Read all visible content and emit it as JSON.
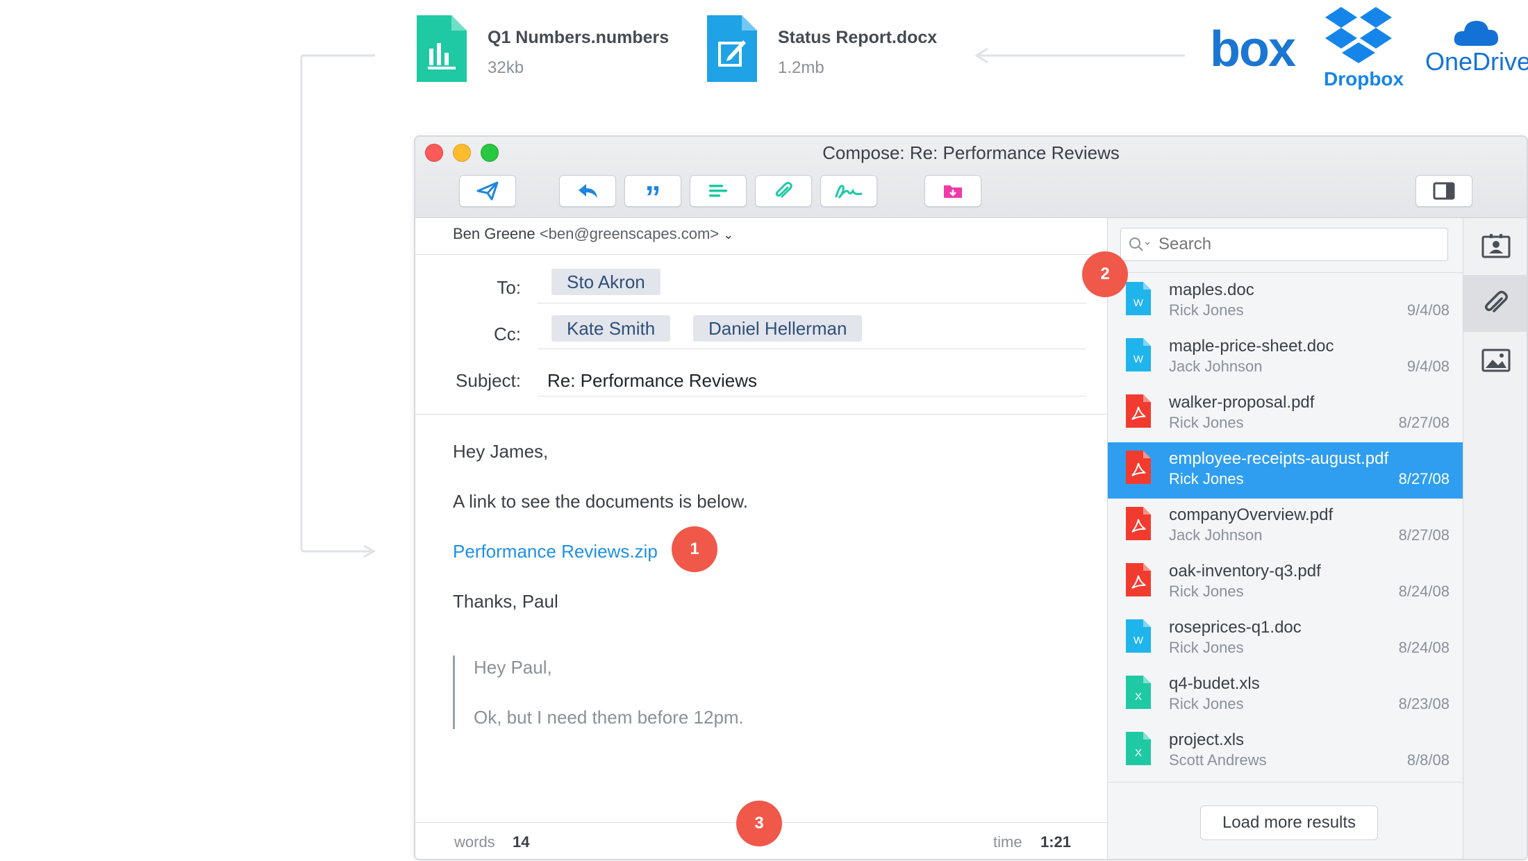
{
  "top_files": [
    {
      "name": "Q1 Numbers.numbers",
      "size": "32kb",
      "color": "#1ec9a4"
    },
    {
      "name": "Status Report.docx",
      "size": "1.2mb",
      "color": "#1fa2e6"
    }
  ],
  "services": {
    "box": "box",
    "dropbox": "Dropbox",
    "onedrive": "OneDrive"
  },
  "window": {
    "title": "Compose: Re: Performance Reviews"
  },
  "toolbar": [
    "send-icon",
    "reply-icon",
    "quote-icon",
    "format-icon",
    "attach-icon",
    "signature-icon",
    "save-folder-icon",
    "sidebar-toggle-icon"
  ],
  "compose": {
    "from_name": "Ben Greene",
    "from_email": "<ben@greenscapes.com>",
    "to_label": "To:",
    "to": [
      "Sto Akron"
    ],
    "cc_label": "Cc:",
    "cc": [
      "Kate Smith",
      "Daniel Hellerman"
    ],
    "subject_label": "Subject:",
    "subject": "Re: Performance Reviews",
    "greeting": "Hey James,",
    "line1": "A link to see the documents is below.",
    "link": "Performance Reviews.zip",
    "signoff": "Thanks, Paul",
    "quote_line1": "Hey Paul,",
    "quote_line2": "Ok, but I need them before 12pm.",
    "words_label": "words",
    "words_value": "14",
    "time_label": "time",
    "time_value": "1:21"
  },
  "badges": {
    "b1": "1",
    "b2": "2",
    "b3": "3"
  },
  "search": {
    "placeholder": "Search"
  },
  "files": [
    {
      "name": "maples.doc",
      "owner": "Rick Jones",
      "date": "9/4/08",
      "type": "W",
      "color": "#1fb4ec"
    },
    {
      "name": "maple-price-sheet.doc",
      "owner": "Jack Johnson",
      "date": "9/4/08",
      "type": "W",
      "color": "#1fb4ec"
    },
    {
      "name": "walker-proposal.pdf",
      "owner": "Rick Jones",
      "date": "8/27/08",
      "type": "pdf",
      "color": "#f23b2f"
    },
    {
      "name": "employee-receipts-august.pdf",
      "owner": "Rick Jones",
      "date": "8/27/08",
      "type": "pdf",
      "color": "#f23b2f"
    },
    {
      "name": "companyOverview.pdf",
      "owner": "Jack Johnson",
      "date": "8/27/08",
      "type": "pdf",
      "color": "#f23b2f"
    },
    {
      "name": "oak-inventory-q3.pdf",
      "owner": "Rick Jones",
      "date": "8/24/08",
      "type": "pdf",
      "color": "#f23b2f"
    },
    {
      "name": "roseprices-q1.doc",
      "owner": "Rick Jones",
      "date": "8/24/08",
      "type": "W",
      "color": "#1fb4ec"
    },
    {
      "name": "q4-budet.xls",
      "owner": "Rick Jones",
      "date": "8/23/08",
      "type": "X",
      "color": "#1ec9a4"
    },
    {
      "name": "project.xls",
      "owner": "Scott Andrews",
      "date": "8/8/08",
      "type": "X",
      "color": "#1ec9a4"
    }
  ],
  "selected_file_index": 3,
  "load_more": "Load more results",
  "rail": [
    "contacts-icon",
    "attachments-icon",
    "images-icon"
  ]
}
